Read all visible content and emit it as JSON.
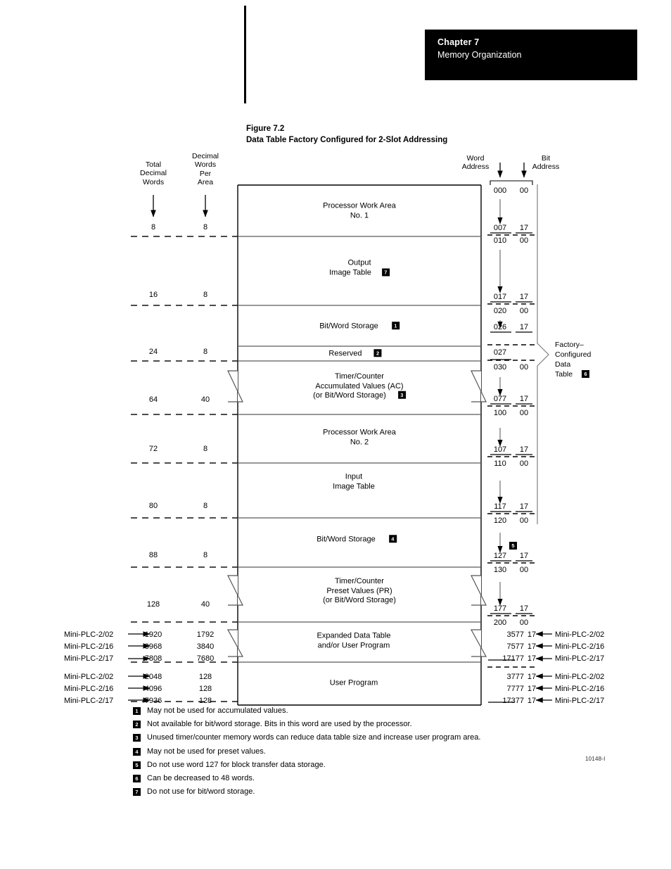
{
  "header": {
    "chapter": "Chapter 7",
    "subject": "Memory Organization"
  },
  "figure": {
    "number": "Figure 7.2",
    "caption": "Data Table Factory Configured for 2-Slot Addressing",
    "doc_id": "10148-I",
    "column_headers": {
      "total_decimal_words": "Total\nDecimal\nWords",
      "total_decimal_words_lines": [
        "Total",
        "Decimal",
        "Words"
      ],
      "decimal_words_per_area_lines": [
        "Decimal",
        "Words",
        "Per",
        "Area"
      ],
      "word_address": "Word\nAddress",
      "word_address_lines": [
        "Word",
        "Address"
      ],
      "bit_address_lines": [
        "Bit",
        "Address"
      ]
    },
    "bracket_label": {
      "lines": [
        "Factory–",
        "Configured",
        "Data",
        "Table"
      ],
      "footnote": "6"
    },
    "rows": [
      {
        "name": "processor-work-area-1",
        "caption_lines": [
          "Processor Work Area",
          "No. 1"
        ],
        "footnote": null,
        "total_decimal_words": "8",
        "decimal_words_per_area": "8",
        "start_word": "000",
        "start_bit": "00",
        "end_word": "007",
        "end_bit": "17"
      },
      {
        "name": "output-image-table",
        "caption_lines": [
          "Output",
          "Image Table"
        ],
        "footnote": "7",
        "total_decimal_words": "16",
        "decimal_words_per_area": "8",
        "start_word": "010",
        "start_bit": "00",
        "end_word": "017",
        "end_bit": "17"
      },
      {
        "name": "bit-word-storage-1",
        "caption_lines": [
          "Bit/Word Storage"
        ],
        "footnote": "1",
        "total_decimal_words": "",
        "decimal_words_per_area": "",
        "start_word": "020",
        "start_bit": "00",
        "end_word": "026",
        "end_bit": "17"
      },
      {
        "name": "reserved",
        "caption_lines": [
          "Reserved"
        ],
        "footnote": "2",
        "total_decimal_words": "24",
        "decimal_words_per_area": "8",
        "start_word": "027",
        "start_bit": "",
        "end_word": "",
        "end_bit": ""
      },
      {
        "name": "timer-counter-accumulated-values",
        "caption_lines": [
          "Timer/Counter",
          "Accumulated Values (AC)",
          "(or Bit/Word Storage)"
        ],
        "footnote": "3",
        "total_decimal_words": "64",
        "decimal_words_per_area": "40",
        "start_word": "030",
        "start_bit": "00",
        "end_word": "077",
        "end_bit": "17"
      },
      {
        "name": "processor-work-area-2",
        "caption_lines": [
          "Processor Work Area",
          "No. 2"
        ],
        "footnote": null,
        "total_decimal_words": "72",
        "decimal_words_per_area": "8",
        "start_word": "100",
        "start_bit": "00",
        "end_word": "107",
        "end_bit": "17"
      },
      {
        "name": "input-image-table",
        "caption_lines": [
          "Input",
          "Image Table"
        ],
        "footnote": null,
        "total_decimal_words": "80",
        "decimal_words_per_area": "8",
        "start_word": "110",
        "start_bit": "00",
        "end_word": "117",
        "end_bit": "17"
      },
      {
        "name": "bit-word-storage-2",
        "caption_lines": [
          "Bit/Word Storage"
        ],
        "footnote": "4",
        "total_decimal_words": "88",
        "decimal_words_per_area": "8",
        "start_word": "120",
        "start_bit": "00",
        "end_word": "127",
        "end_bit": "17",
        "end_footnote": "5"
      },
      {
        "name": "timer-counter-preset-values",
        "caption_lines": [
          "Timer/Counter",
          "Preset Values (PR)",
          "(or Bit/Word Storage)"
        ],
        "footnote": null,
        "total_decimal_words": "128",
        "decimal_words_per_area": "40",
        "start_word": "130",
        "start_bit": "00",
        "end_word": "177",
        "end_bit": "17"
      },
      {
        "name": "expanded-data-table",
        "caption_lines": [
          "Expanded Data Table",
          "and/or User Program"
        ],
        "footnote": null,
        "start_word": "200",
        "start_bit": "00"
      },
      {
        "name": "user-program",
        "caption_lines": [
          "User Program"
        ],
        "footnote": null
      }
    ],
    "expanded_data_table": {
      "left_models": [
        {
          "model": "Mini-PLC-2/02",
          "total_decimal_words": "1920",
          "decimal_words_per_area": "1792"
        },
        {
          "model": "Mini-PLC-2/16",
          "total_decimal_words": "3968",
          "decimal_words_per_area": "3840"
        },
        {
          "model": "Mini-PLC-2/17",
          "total_decimal_words": "7808",
          "decimal_words_per_area": "7680"
        }
      ],
      "right_models": [
        {
          "word": "3577",
          "bit": "17",
          "model": "Mini-PLC-2/02"
        },
        {
          "word": "7577",
          "bit": "17",
          "model": "Mini-PLC-2/16"
        },
        {
          "word": "17177",
          "bit": "17",
          "model": "Mini-PLC-2/17"
        }
      ]
    },
    "user_program": {
      "left_models": [
        {
          "model": "Mini-PLC-2/02",
          "total_decimal_words": "2048",
          "decimal_words_per_area": "128"
        },
        {
          "model": "Mini-PLC-2/16",
          "total_decimal_words": "4096",
          "decimal_words_per_area": "128"
        },
        {
          "model": "Mini-PLC-2/17",
          "total_decimal_words": "7936",
          "decimal_words_per_area": "128"
        }
      ],
      "right_models": [
        {
          "word": "3777",
          "bit": "17",
          "model": "Mini-PLC-2/02"
        },
        {
          "word": "7777",
          "bit": "17",
          "model": "Mini-PLC-2/16"
        },
        {
          "word": "17377",
          "bit": "17",
          "model": "Mini-PLC-2/17"
        }
      ]
    },
    "footnotes": [
      {
        "num": "1",
        "text": "May not be used for accumulated values."
      },
      {
        "num": "2",
        "text": "Not available for bit/word storage.  Bits in this word are used by the processor."
      },
      {
        "num": "3",
        "text": "Unused timer/counter memory words can reduce data table size and increase user program area."
      },
      {
        "num": "4",
        "text": "May not be used for preset values."
      },
      {
        "num": "5",
        "text": "Do not use word 127 for block transfer data storage."
      },
      {
        "num": "6",
        "text": "Can be decreased to 48 words."
      },
      {
        "num": "7",
        "text": "Do not use for bit/word storage."
      }
    ]
  },
  "colors": {
    "ink": "#000000",
    "header_bg": "#000000",
    "header_fg": "#ffffff",
    "rule": "#4d4d4d",
    "dashed": "#1a1a1a"
  }
}
